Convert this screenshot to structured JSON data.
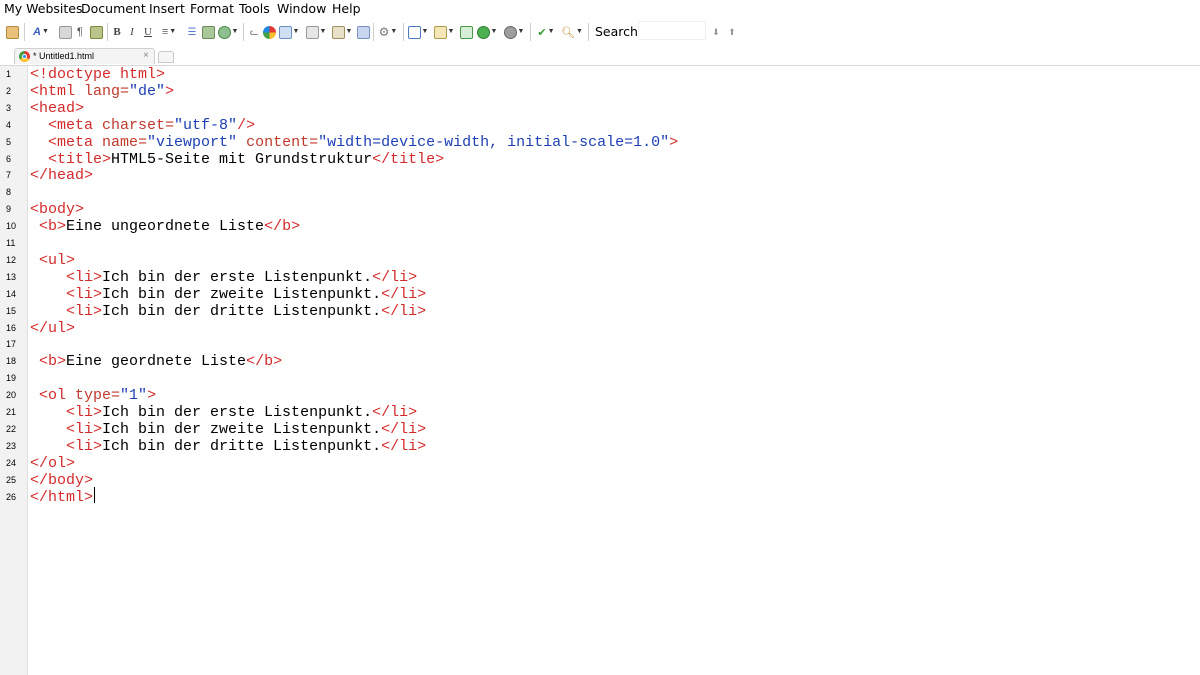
{
  "menubar": {
    "items": [
      {
        "label": "My Websites"
      },
      {
        "label": "Document"
      },
      {
        "label": "Insert"
      },
      {
        "label": "Format"
      },
      {
        "label": "Tools"
      },
      {
        "label": "Window"
      },
      {
        "label": "Help"
      }
    ]
  },
  "toolbar": {
    "bold_label": "B",
    "italic_label": "I",
    "underline_label": "U",
    "icons": [
      "paste-icon",
      "font-icon",
      "print-icon",
      "paragraph-icon",
      "print-preview-icon",
      "bold-icon",
      "italic-icon",
      "underline-icon",
      "align-icon",
      "list-icon",
      "image-icon",
      "web-icon",
      "anchor-icon",
      "color-icon",
      "table-icon",
      "form-icon",
      "edit-icon",
      "layers-icon",
      "settings-icon",
      "insert-icon",
      "window-icon",
      "link-icon",
      "browser-icon",
      "shape-icon",
      "spellcheck-icon",
      "find-icon",
      "arrow-down-icon",
      "home-icon"
    ],
    "search": {
      "label": "Search:",
      "value": "",
      "placeholder": ""
    }
  },
  "tabs": [
    {
      "label": "* Untitled1.html",
      "close": "×"
    }
  ],
  "editor": {
    "line_numbers": [
      "1",
      "2",
      "3",
      "4",
      "5",
      "6",
      "7",
      "8",
      "9",
      "10",
      "11",
      "12",
      "13",
      "14",
      "15",
      "16",
      "17",
      "18",
      "19",
      "20",
      "21",
      "22",
      "23",
      "24",
      "25",
      "26"
    ],
    "lines": [
      [
        [
          "t",
          "<!doctype html>"
        ]
      ],
      [
        [
          "t",
          "<html "
        ],
        [
          "a",
          "lang="
        ],
        [
          "v",
          "\"de\""
        ],
        [
          "t",
          ">"
        ]
      ],
      [
        [
          "t",
          "<head>"
        ]
      ],
      [
        [
          "x",
          "  "
        ],
        [
          "t",
          "<meta "
        ],
        [
          "a",
          "charset="
        ],
        [
          "v",
          "\"utf-8\""
        ],
        [
          "t",
          "/>"
        ]
      ],
      [
        [
          "x",
          "  "
        ],
        [
          "t",
          "<meta "
        ],
        [
          "a",
          "name="
        ],
        [
          "v",
          "\"viewport\""
        ],
        [
          "a",
          " content="
        ],
        [
          "v",
          "\"width=device-width, initial-scale=1.0\""
        ],
        [
          "t",
          ">"
        ]
      ],
      [
        [
          "x",
          "  "
        ],
        [
          "t",
          "<title>"
        ],
        [
          "x",
          "HTML5-Seite mit Grundstruktur"
        ],
        [
          "t",
          "</title>"
        ]
      ],
      [
        [
          "t",
          "</head>"
        ]
      ],
      [],
      [
        [
          "t",
          "<body>"
        ]
      ],
      [
        [
          "x",
          " "
        ],
        [
          "t",
          "<b>"
        ],
        [
          "x",
          "Eine ungeordnete Liste"
        ],
        [
          "t",
          "</b>"
        ]
      ],
      [],
      [
        [
          "x",
          " "
        ],
        [
          "t",
          "<ul>"
        ]
      ],
      [
        [
          "x",
          "    "
        ],
        [
          "t",
          "<li>"
        ],
        [
          "x",
          "Ich bin der erste Listenpunkt."
        ],
        [
          "t",
          "</li>"
        ]
      ],
      [
        [
          "x",
          "    "
        ],
        [
          "t",
          "<li>"
        ],
        [
          "x",
          "Ich bin der zweite Listenpunkt."
        ],
        [
          "t",
          "</li>"
        ]
      ],
      [
        [
          "x",
          "    "
        ],
        [
          "t",
          "<li>"
        ],
        [
          "x",
          "Ich bin der dritte Listenpunkt."
        ],
        [
          "t",
          "</li>"
        ]
      ],
      [
        [
          "t",
          "</ul>"
        ]
      ],
      [],
      [
        [
          "x",
          " "
        ],
        [
          "t",
          "<b>"
        ],
        [
          "x",
          "Eine geordnete Liste"
        ],
        [
          "t",
          "</b>"
        ]
      ],
      [],
      [
        [
          "x",
          " "
        ],
        [
          "t",
          "<ol "
        ],
        [
          "a",
          "type="
        ],
        [
          "v",
          "\"1\""
        ],
        [
          "t",
          ">"
        ]
      ],
      [
        [
          "x",
          "    "
        ],
        [
          "t",
          "<li>"
        ],
        [
          "x",
          "Ich bin der erste Listenpunkt."
        ],
        [
          "t",
          "</li>"
        ]
      ],
      [
        [
          "x",
          "    "
        ],
        [
          "t",
          "<li>"
        ],
        [
          "x",
          "Ich bin der zweite Listenpunkt."
        ],
        [
          "t",
          "</li>"
        ]
      ],
      [
        [
          "x",
          "    "
        ],
        [
          "t",
          "<li>"
        ],
        [
          "x",
          "Ich bin der dritte Listenpunkt."
        ],
        [
          "t",
          "</li>"
        ]
      ],
      [
        [
          "t",
          "</ol>"
        ]
      ],
      [
        [
          "t",
          "</body>"
        ]
      ],
      [
        [
          "t",
          "</html>"
        ]
      ]
    ]
  },
  "colors": {
    "tag": "#d42a2a",
    "attribute": "#c0392b",
    "value": "#1c3fb5",
    "text": "#000000",
    "gutter": "#f2f2f2"
  }
}
